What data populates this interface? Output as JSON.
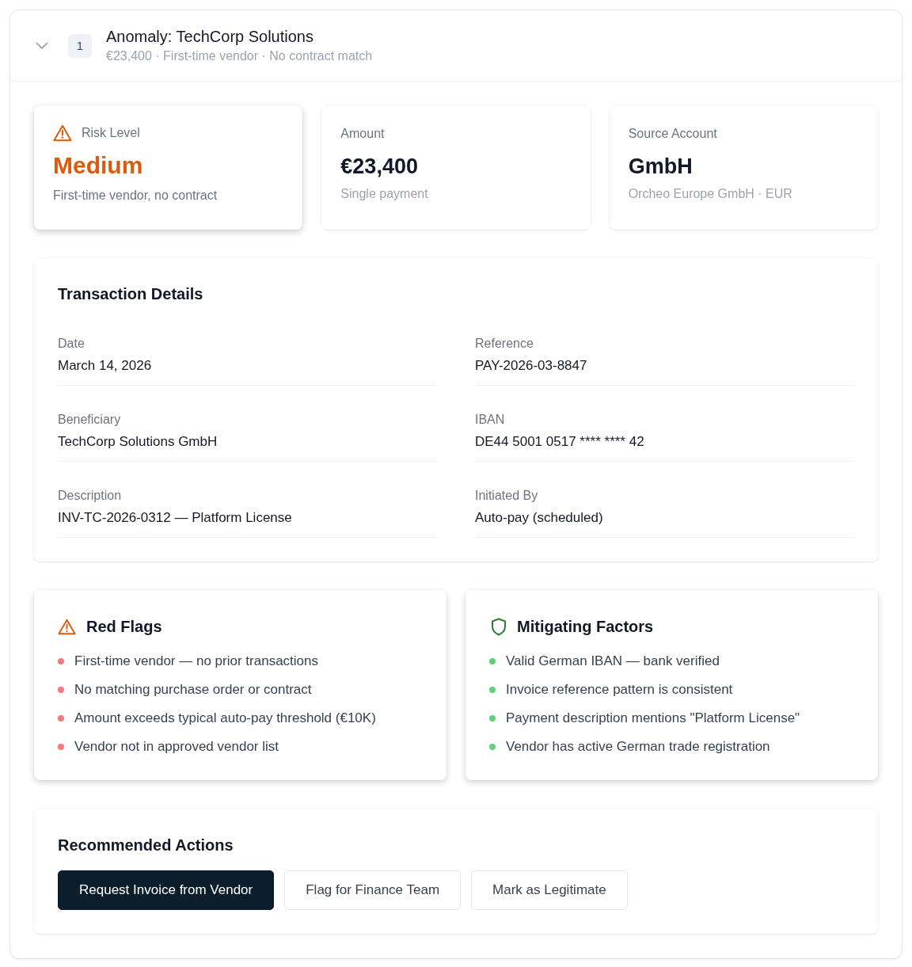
{
  "header": {
    "expanded": true,
    "index": "1",
    "title": "Anomaly: TechCorp Solutions",
    "subtitle": "€23,400 · First-time vendor · No contract match"
  },
  "summary_cards": [
    {
      "kind": "risk",
      "label": "Risk Level",
      "value": "Medium",
      "note": "First-time vendor, no contract"
    },
    {
      "kind": "plain",
      "label": "Amount",
      "value": "€23,400",
      "note": "Single payment"
    },
    {
      "kind": "plain",
      "label": "Source Account",
      "value": "GmbH",
      "note": "Orcheo Europe GmbH · EUR"
    }
  ],
  "transaction_details": {
    "title": "Transaction Details",
    "fields": [
      {
        "label": "Date",
        "value": "March 14, 2026"
      },
      {
        "label": "Reference",
        "value": "PAY-2026-03-8847"
      },
      {
        "label": "Beneficiary",
        "value": "TechCorp Solutions GmbH"
      },
      {
        "label": "IBAN",
        "value": "DE44 5001 0517 **** **** 42"
      },
      {
        "label": "Description",
        "value": "INV-TC-2026-0312 — Platform License"
      },
      {
        "label": "Initiated By",
        "value": "Auto-pay (scheduled)"
      }
    ]
  },
  "factor_panels": [
    {
      "kind": "risk",
      "title": "Red Flags",
      "items": [
        "First-time vendor — no prior transactions",
        "No matching purchase order or contract",
        "Amount exceeds typical auto-pay threshold (€10K)",
        "Vendor not in approved vendor list"
      ]
    },
    {
      "kind": "mitigating",
      "title": "Mitigating Factors",
      "items": [
        "Valid German IBAN — bank verified",
        "Invoice reference pattern is consistent",
        "Payment description mentions \"Platform License\"",
        "Vendor has active German trade registration"
      ]
    }
  ],
  "recommended_actions": {
    "title": "Recommended Actions",
    "buttons": [
      {
        "kind": "primary",
        "label": "Request Invoice from Vendor"
      },
      {
        "kind": "secondary",
        "label": "Flag for Finance Team"
      },
      {
        "kind": "secondary",
        "label": "Mark as Legitimate"
      }
    ]
  }
}
